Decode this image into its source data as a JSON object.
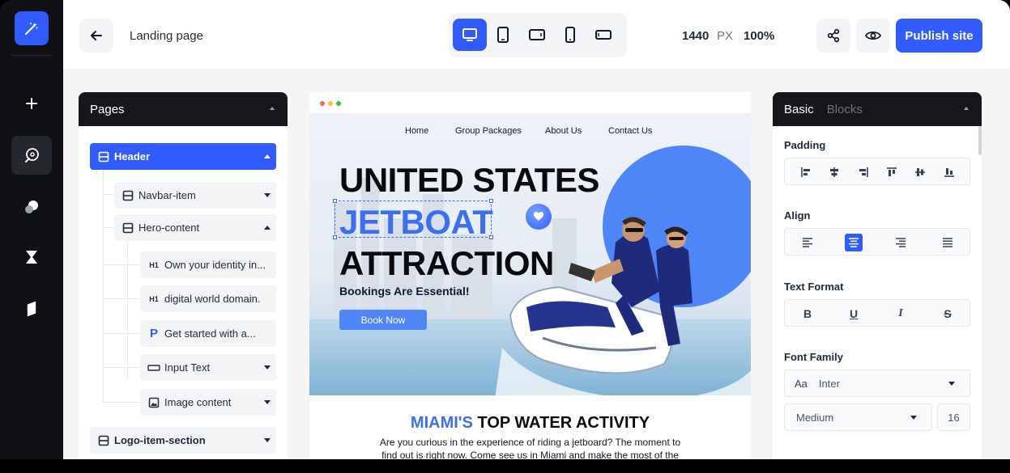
{
  "topbar": {
    "page_name": "Landing page",
    "canvas_width": "1440",
    "canvas_unit": "PX",
    "zoom": "100%",
    "publish_label": "Publish site",
    "active_device": "desktop"
  },
  "rail": {
    "icons": [
      "magic-wand-icon",
      "plus-icon",
      "paint-icon",
      "shapes-icon",
      "hourglass-icon",
      "eraser-icon"
    ]
  },
  "pages_panel": {
    "title": "Pages",
    "items": [
      {
        "label": "Header",
        "icon": "section-icon",
        "caret": "up",
        "selected": true
      },
      {
        "label": "Navbar-item",
        "icon": "section-icon",
        "caret": "down"
      },
      {
        "label": "Hero-content",
        "icon": "section-icon",
        "caret": "up"
      },
      {
        "label": "Own your identity in...",
        "icon": "H1"
      },
      {
        "label": "digital world domain.",
        "icon": "H1"
      },
      {
        "label": "Get started with a...",
        "icon": "P"
      },
      {
        "label": "Input Text",
        "icon": "input-icon",
        "caret": "down"
      },
      {
        "label": "Image content",
        "icon": "image-icon",
        "caret": "down"
      },
      {
        "label": "Logo-item-section",
        "icon": "section-icon",
        "caret": "down"
      }
    ]
  },
  "preview": {
    "nav": [
      "Home",
      "Group Packages",
      "About Us",
      "Contact Us"
    ],
    "hero_line1": "UNITED STATES",
    "hero_line2": "JETBOAT",
    "hero_line3": "ATTRACTION",
    "hero_sub": "Bookings Are Essential!",
    "cta": "Book Now",
    "section_title_accent": "MIAMI'S",
    "section_title_rest": " TOP WATER ACTIVITY",
    "section_text": "Are you curious in the experience of riding a jetboard? The moment to find out is right now. Come see us in Miami and make the most of the"
  },
  "props": {
    "tab_basic": "Basic",
    "tab_blocks": "Blocks",
    "padding_label": "Padding",
    "align_label": "Align",
    "text_format_label": "Text Format",
    "font_family_label": "Font Family",
    "font_family_prefix": "Aa",
    "font_family_value": "Inter",
    "font_weight_value": "Medium",
    "font_size_value": "16",
    "align_active": "center",
    "format_buttons": [
      "B",
      "U",
      "I",
      "S"
    ]
  },
  "colors": {
    "accent": "#2f5bff",
    "hero_blue": "#3b6ff0",
    "dark_panel": "#15171b",
    "rail_bg": "#0f1115"
  }
}
